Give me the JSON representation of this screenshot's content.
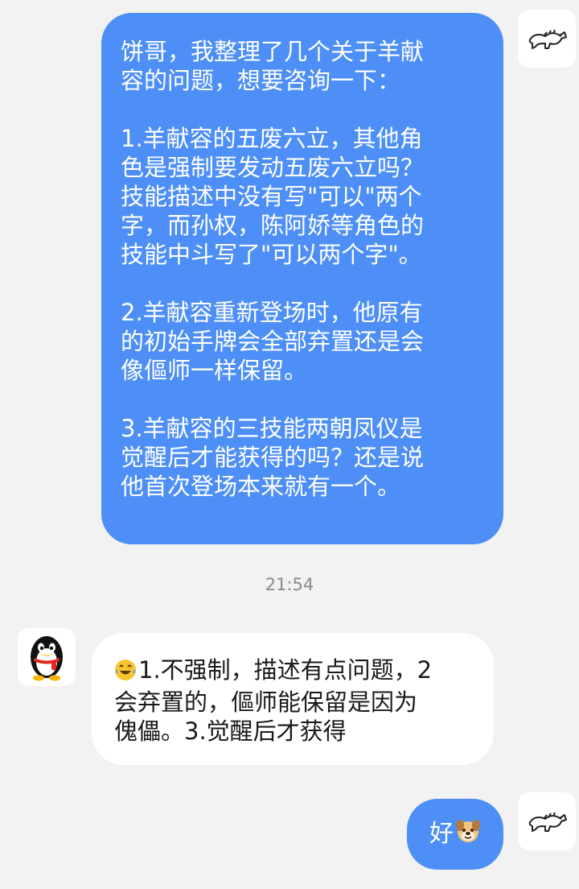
{
  "messages": {
    "first": {
      "p1": "饼哥，我整理了几个关于羊献\n容的问题，想要咨询一下：",
      "p2": "1.羊献容的五废六立，其他角\n色是强制要发动五废六立吗？\n技能描述中没有写\"可以\"两个\n字，而孙权，陈阿娇等角色的\n技能中斗写了\"可以两个字\"。",
      "p3": "2.羊献容重新登场时，他原有\n的初始手牌会全部弃置还是会\n像傴师一样保留。",
      "p4": "3.羊献容的三技能两朝凤仪是\n觉醒后才能获得的吗？还是说\n他首次登场本来就有一个。"
    },
    "timestamp": "21:54",
    "reply": {
      "text": "1.不强制，描述有点问题，2\n会弃置的，傴师能保留是因为\n傀儡。3.觉醒后才获得",
      "emoji": "laughing-tears-emoji"
    },
    "ack": {
      "text": "好",
      "emoji": "dog-face-emoji"
    }
  },
  "avatars": {
    "me": "horse-doodle-avatar",
    "other": "qq-penguin-avatar"
  },
  "colors": {
    "outgoing_bubble": "#4d8ff6",
    "incoming_bubble": "#ffffff",
    "background": "#f2f2f2",
    "timestamp": "#8a8a8a"
  }
}
